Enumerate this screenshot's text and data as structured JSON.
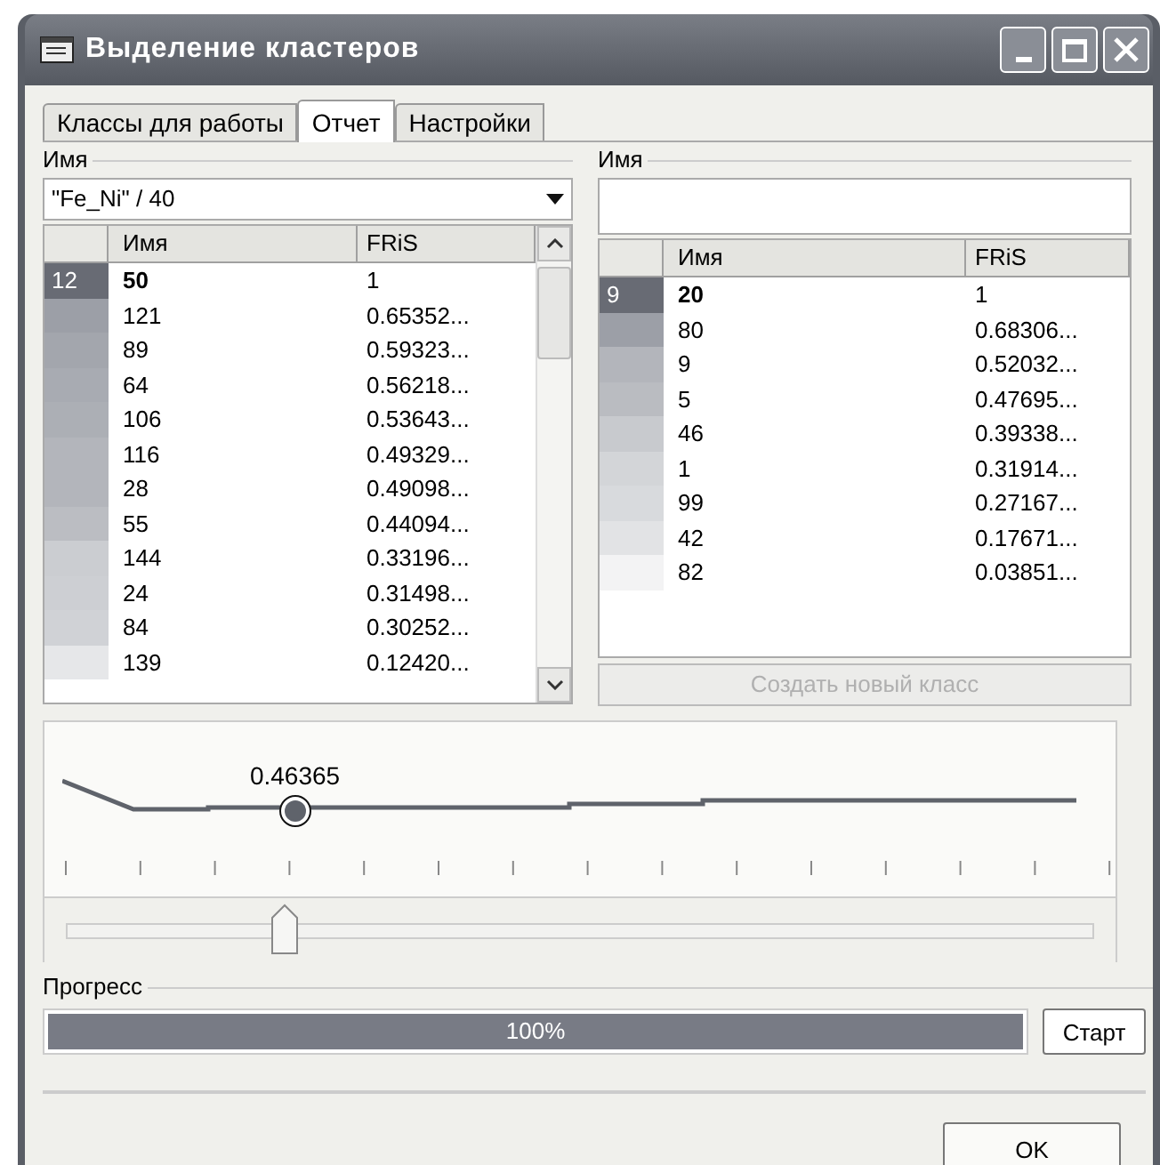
{
  "window": {
    "title": "Выделение кластеров"
  },
  "tabs": [
    {
      "label": "Классы для работы",
      "selected": false
    },
    {
      "label": "Отчет",
      "selected": true
    },
    {
      "label": "Настройки",
      "selected": false
    }
  ],
  "left_panel": {
    "group_label": "Имя",
    "combo": {
      "value": "\"Fe_Ni\" / 40"
    },
    "columns": [
      "Имя",
      "FRiS"
    ],
    "rows": [
      {
        "index": "12",
        "name": "50",
        "fris": "1",
        "selected": true,
        "color": "#686b74"
      },
      {
        "name": "121",
        "fris": "0.65352...",
        "selected": false,
        "color": "#9c9fa7"
      },
      {
        "name": "89",
        "fris": "0.59323...",
        "selected": false,
        "color": "#a3a6ad"
      },
      {
        "name": "64",
        "fris": "0.56218...",
        "selected": false,
        "color": "#a8abb2"
      },
      {
        "name": "106",
        "fris": "0.53643...",
        "selected": false,
        "color": "#acafb5"
      },
      {
        "name": "116",
        "fris": "0.49329...",
        "selected": false,
        "color": "#b3b5bb"
      },
      {
        "name": "28",
        "fris": "0.49098...",
        "selected": false,
        "color": "#b3b5bb"
      },
      {
        "name": "55",
        "fris": "0.44094...",
        "selected": false,
        "color": "#bbbdc2"
      },
      {
        "name": "144",
        "fris": "0.33196...",
        "selected": false,
        "color": "#cbcdd1"
      },
      {
        "name": "24",
        "fris": "0.31498...",
        "selected": false,
        "color": "#cdcfd3"
      },
      {
        "name": "84",
        "fris": "0.30252...",
        "selected": false,
        "color": "#d0d2d6"
      },
      {
        "name": "139",
        "fris": "0.12420...",
        "selected": false,
        "color": "#e6e7e9"
      }
    ]
  },
  "right_panel": {
    "group_label": "Имя",
    "columns": [
      "Имя",
      "FRiS"
    ],
    "rows": [
      {
        "index": "9",
        "name": "20",
        "fris": "1",
        "selected": true,
        "color": "#686b74"
      },
      {
        "name": "80",
        "fris": "0.68306...",
        "selected": false,
        "color": "#9c9fa7"
      },
      {
        "name": "9",
        "fris": "0.52032...",
        "selected": false,
        "color": "#b3b5bb"
      },
      {
        "name": "5",
        "fris": "0.47695...",
        "selected": false,
        "color": "#babcc1"
      },
      {
        "name": "46",
        "fris": "0.39338...",
        "selected": false,
        "color": "#c8cace"
      },
      {
        "name": "1",
        "fris": "0.31914...",
        "selected": false,
        "color": "#d3d5d8"
      },
      {
        "name": "99",
        "fris": "0.27167...",
        "selected": false,
        "color": "#d8dadd"
      },
      {
        "name": "42",
        "fris": "0.17671...",
        "selected": false,
        "color": "#e2e3e5"
      },
      {
        "name": "82",
        "fris": "0.03851...",
        "selected": false,
        "color": "#f3f3f4"
      }
    ],
    "create_button": {
      "label": "Создать новый класс",
      "disabled": true
    }
  },
  "threshold": {
    "marker_value": "0.46365",
    "level": 0.213
  },
  "progress": {
    "label": "Прогресс",
    "level": 1,
    "text": "100%",
    "start_button": "Старт"
  },
  "ok_button": "OK"
}
